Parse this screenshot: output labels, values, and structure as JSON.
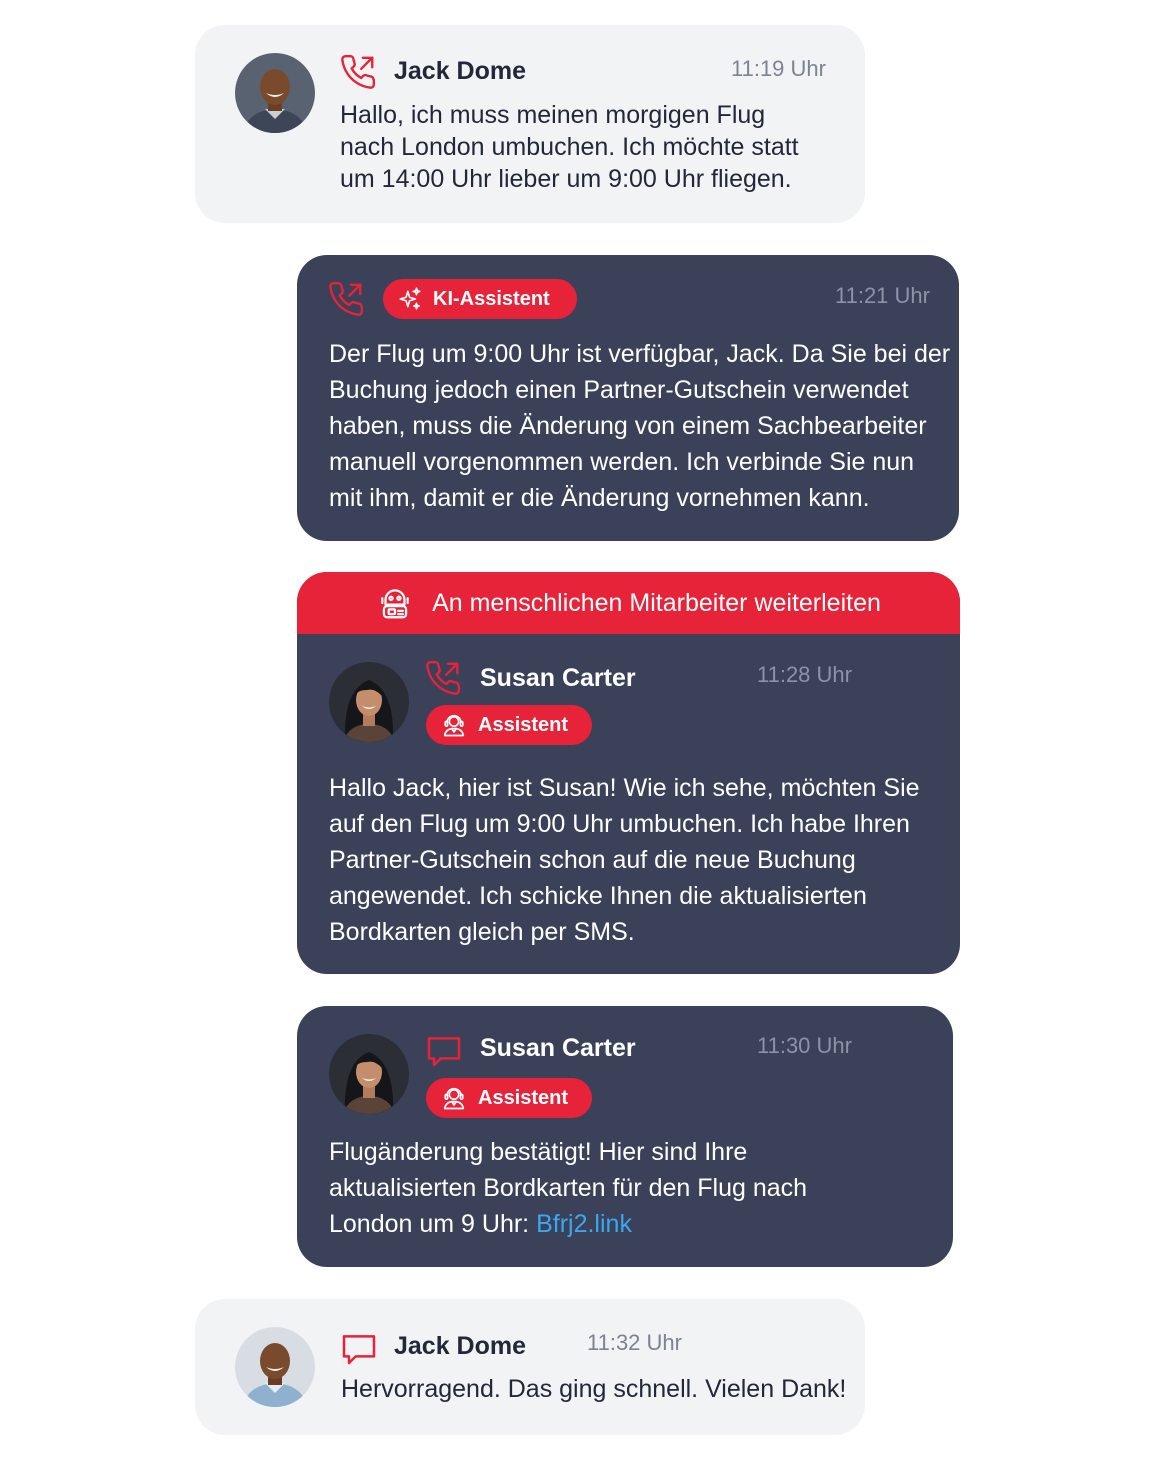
{
  "colors": {
    "accent": "#e62339",
    "dark_card": "#3a4159",
    "light_card": "#f2f3f5",
    "link": "#3aa7f0"
  },
  "messages": [
    {
      "sender": "Jack Dome",
      "time": "11:19 Uhr",
      "channel_icon": "phone-outgoing-icon",
      "text": [
        "Hallo, ich muss meinen morgigen Flug",
        "nach London umbuchen. Ich möchte statt",
        "um 14:00 Uhr lieber um 9:00 Uhr fliegen."
      ]
    },
    {
      "badge": "KI-Assistent",
      "time": "11:21 Uhr",
      "channel_icon": "phone-outgoing-icon",
      "text": [
        "Der Flug um 9:00 Uhr ist verfügbar, Jack. Da Sie bei der",
        "Buchung jedoch einen Partner-Gutschein verwendet",
        "haben, muss die Änderung von einem Sachbearbeiter",
        "manuell vorgenommen werden. Ich verbinde Sie nun",
        "mit ihm, damit er die Änderung vornehmen kann."
      ]
    },
    {
      "banner": "An menschlichen Mitarbeiter weiterleiten",
      "sender": "Susan Carter",
      "badge": "Assistent",
      "time": "11:28 Uhr",
      "channel_icon": "phone-outgoing-icon",
      "text": [
        "Hallo Jack, hier ist Susan! Wie ich sehe, möchten Sie",
        "auf den Flug um 9:00 Uhr umbuchen. Ich habe Ihren",
        "Partner-Gutschein schon auf die neue Buchung",
        "angewendet. Ich schicke Ihnen die aktualisierten",
        "Bordkarten gleich per SMS."
      ]
    },
    {
      "sender": "Susan Carter",
      "badge": "Assistent",
      "time": "11:30 Uhr",
      "channel_icon": "chat-bubble-icon",
      "text": [
        "Flugänderung bestätigt! Hier sind Ihre",
        "aktualisierten Bordkarten für den Flug nach",
        "London um 9 Uhr: "
      ],
      "link": "Bfrj2.link"
    },
    {
      "sender": "Jack Dome",
      "time": "11:32 Uhr",
      "channel_icon": "chat-bubble-icon",
      "text": [
        "Hervorragend. Das ging schnell. Vielen Dank!"
      ]
    }
  ]
}
